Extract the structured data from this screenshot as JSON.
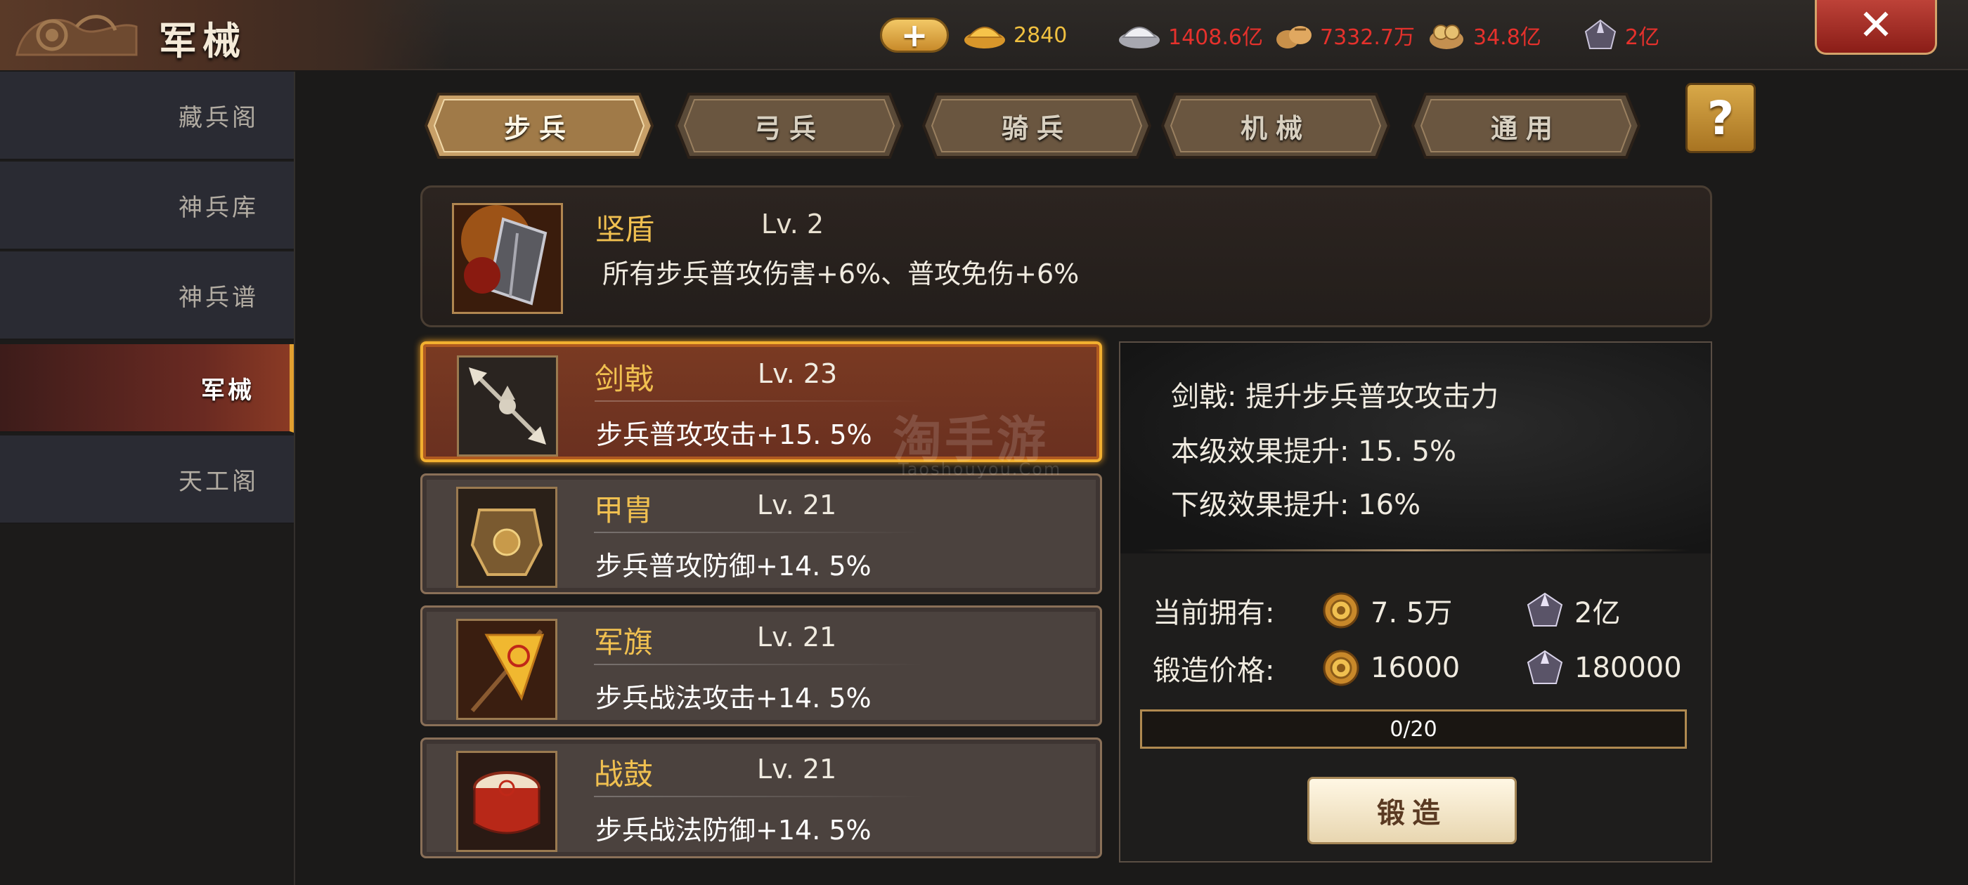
{
  "header": {
    "title": "军械"
  },
  "resources": [
    {
      "icon": "gold-ingot-icon",
      "value": "2840",
      "color": "#f0c040"
    },
    {
      "icon": "silver-ingot-icon",
      "value": "1408.6亿",
      "color": "#e5312c"
    },
    {
      "icon": "grain-sack-icon",
      "value": "7332.7万",
      "color": "#e5312c"
    },
    {
      "icon": "coin-bag-icon",
      "value": "34.8亿",
      "color": "#e5312c"
    },
    {
      "icon": "ore-crystal-icon",
      "value": "2亿",
      "color": "#e5312c"
    }
  ],
  "sidebar": {
    "items": [
      {
        "label": "藏兵阁",
        "active": false
      },
      {
        "label": "神兵库",
        "active": false
      },
      {
        "label": "神兵谱",
        "active": false
      },
      {
        "label": "军械",
        "active": true
      },
      {
        "label": "天工阁",
        "active": false
      }
    ]
  },
  "tabs": [
    {
      "label": "步兵",
      "active": true
    },
    {
      "label": "弓兵",
      "active": false
    },
    {
      "label": "骑兵",
      "active": false
    },
    {
      "label": "机械",
      "active": false
    },
    {
      "label": "通用",
      "active": false
    }
  ],
  "featured": {
    "name": "坚盾",
    "level": "Lv. 2",
    "desc": "所有步兵普攻伤害+6%、普攻免伤+6%"
  },
  "equipment": [
    {
      "name": "剑戟",
      "level": "Lv. 23",
      "desc": "步兵普攻攻击+15. 5%",
      "active": true
    },
    {
      "name": "甲胄",
      "level": "Lv. 21",
      "desc": "步兵普攻防御+14. 5%",
      "active": false
    },
    {
      "name": "军旗",
      "level": "Lv. 21",
      "desc": "步兵战法攻击+14. 5%",
      "active": false
    },
    {
      "name": "战鼓",
      "level": "Lv. 21",
      "desc": "步兵战法防御+14. 5%",
      "active": false
    }
  ],
  "detail": {
    "title": "剑戟:  提升步兵普攻攻击力",
    "current": "本级效果提升:  15. 5%",
    "next": "下级效果提升:  16%",
    "owned_label": "当前拥有:",
    "owned_gear": "7. 5万",
    "owned_ore": "2亿",
    "cost_label": "锻造价格:",
    "cost_gear": "16000",
    "cost_ore": "180000",
    "progress_text": "0/20",
    "progress_value": 0,
    "forge_label": "锻造"
  },
  "watermark": {
    "main": "淘手游",
    "sub": "Taoshouyou.Com"
  }
}
